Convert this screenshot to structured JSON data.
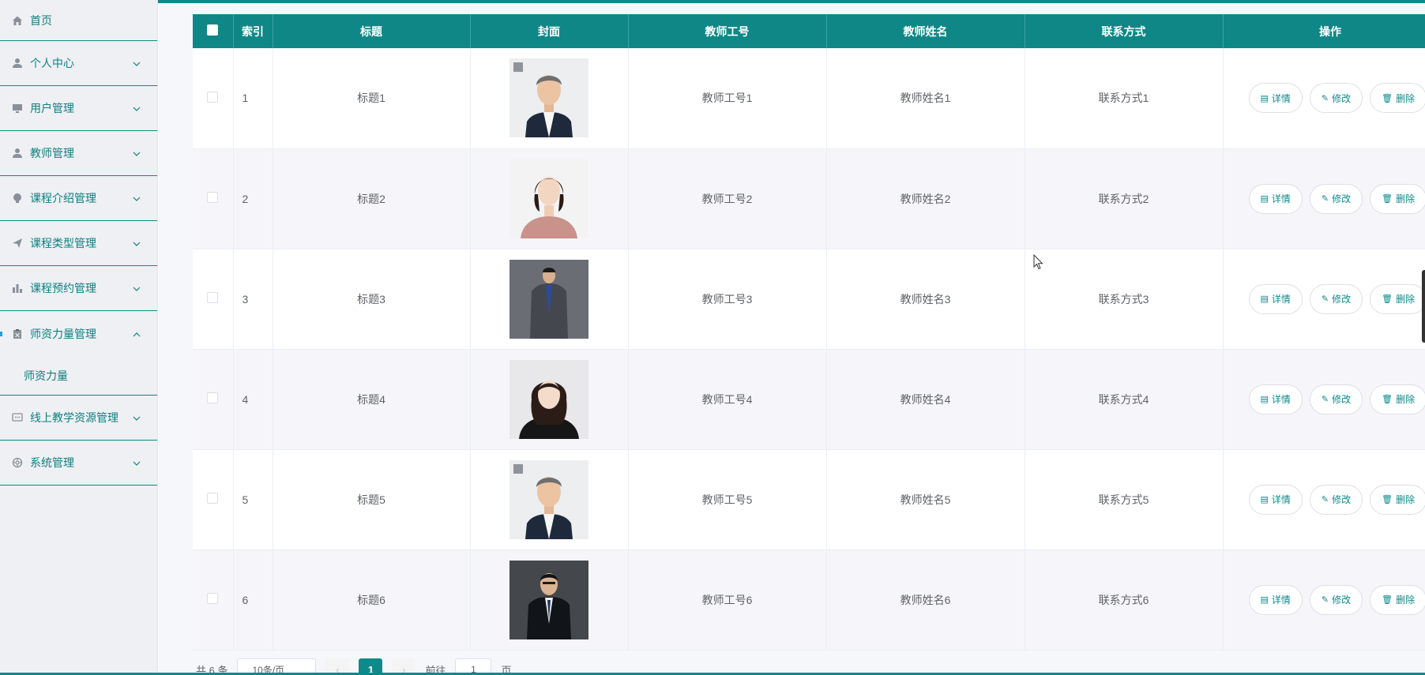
{
  "sidebar": {
    "items": [
      {
        "label": "首页",
        "icon": "home-icon",
        "chevron": "none"
      },
      {
        "label": "个人中心",
        "icon": "user-icon",
        "chevron": "down"
      },
      {
        "label": "用户管理",
        "icon": "monitor-icon",
        "chevron": "down"
      },
      {
        "label": "教师管理",
        "icon": "user-icon",
        "chevron": "down"
      },
      {
        "label": "课程介绍管理",
        "icon": "bulb-icon",
        "chevron": "down"
      },
      {
        "label": "课程类型管理",
        "icon": "send-icon",
        "chevron": "down"
      },
      {
        "label": "课程预约管理",
        "icon": "bar-chart-icon",
        "chevron": "down"
      },
      {
        "label": "师资力量管理",
        "icon": "clipboard-icon",
        "chevron": "up"
      },
      {
        "label": "线上教学资源管理",
        "icon": "message-icon",
        "chevron": "down"
      },
      {
        "label": "系统管理",
        "icon": "settings-icon",
        "chevron": "down"
      }
    ],
    "sub_item": "师资力量"
  },
  "table": {
    "headers": {
      "index": "索引",
      "title": "标题",
      "cover": "封面",
      "teacher_id": "教师工号",
      "teacher_name": "教师姓名",
      "contact": "联系方式",
      "actions": "操作"
    },
    "rows": [
      {
        "index": "1",
        "title": "标题1",
        "teacher_id": "教师工号1",
        "teacher_name": "教师姓名1",
        "contact": "联系方式1",
        "cover": "portrait-man-grey-hair"
      },
      {
        "index": "2",
        "title": "标题2",
        "teacher_id": "教师工号2",
        "teacher_name": "教师姓名2",
        "contact": "联系方式2",
        "cover": "portrait-woman-pink-blouse"
      },
      {
        "index": "3",
        "title": "标题3",
        "teacher_id": "教师工号3",
        "teacher_name": "教师姓名3",
        "contact": "联系方式3",
        "cover": "portrait-man-grey-suit"
      },
      {
        "index": "4",
        "title": "标题4",
        "teacher_id": "教师工号4",
        "teacher_name": "教师姓名4",
        "contact": "联系方式4",
        "cover": "portrait-woman-black-top"
      },
      {
        "index": "5",
        "title": "标题5",
        "teacher_id": "教师工号5",
        "teacher_name": "教师姓名5",
        "contact": "联系方式5",
        "cover": "portrait-man-grey-hair"
      },
      {
        "index": "6",
        "title": "标题6",
        "teacher_id": "教师工号6",
        "teacher_name": "教师姓名6",
        "contact": "联系方式6",
        "cover": "portrait-man-dark-suit"
      }
    ],
    "actions": {
      "detail": "详情",
      "edit": "修改",
      "delete": "删除"
    }
  },
  "pagination": {
    "total": "共 6 条",
    "page_size": "10条/页",
    "current_page": "1",
    "goto_label": "前往",
    "goto_value": "1",
    "page_unit": "页"
  },
  "colors": {
    "primary": "#0f8787",
    "sidebar_text": "#0f7f80",
    "sidebar_bg": "#eef0f3"
  }
}
